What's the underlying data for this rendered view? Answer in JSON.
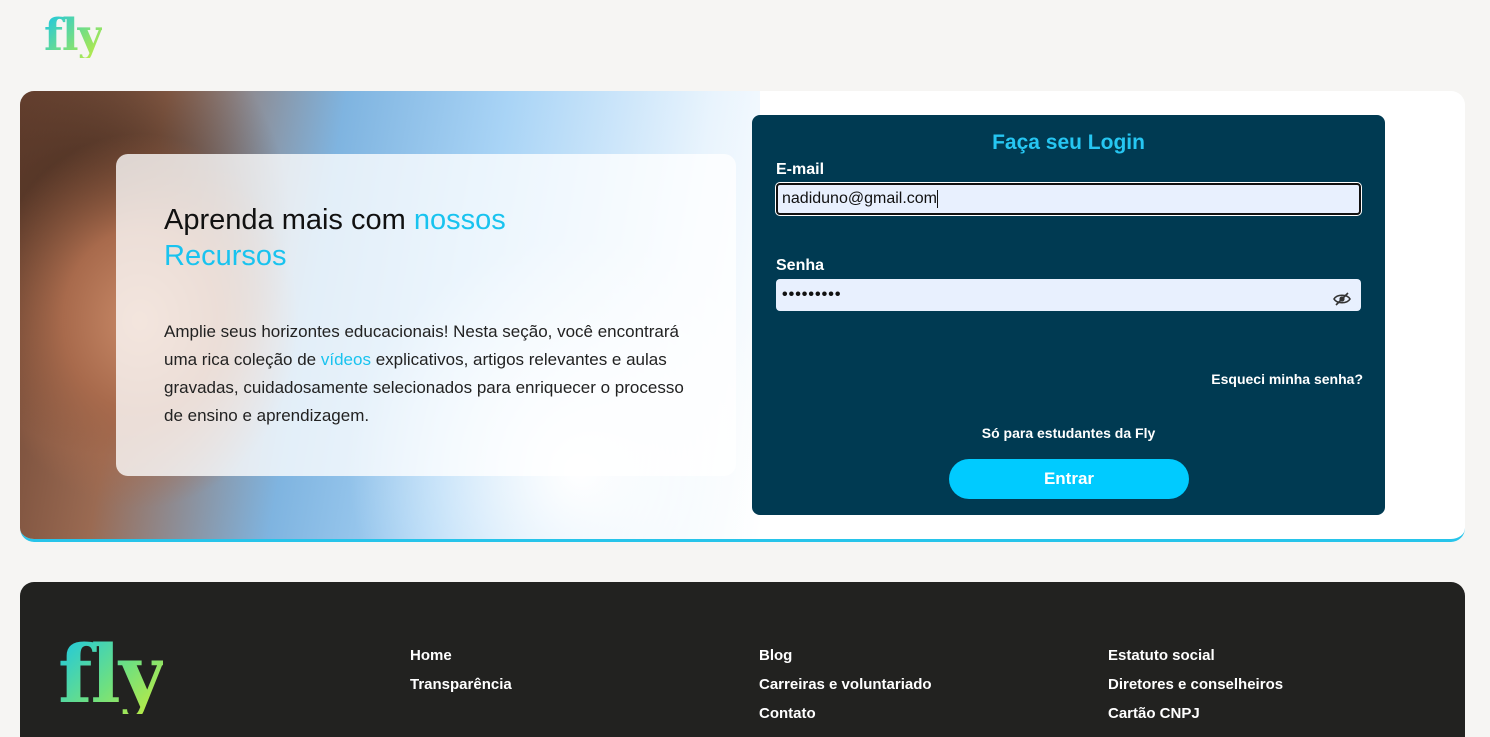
{
  "brand": {
    "logo_text": "fly",
    "accent": "#19c3ef",
    "login_bg": "#003a52",
    "button_bg": "#00cbff",
    "footer_bg": "#222220"
  },
  "hero": {
    "title_part1": "Aprenda mais com",
    "title_accent1": "nossos",
    "title_accent2": "Recursos",
    "text_before_link": "Amplie seus horizontes educacionais! Nesta seção, você encontrará uma rica coleção de",
    "text_link": "vídeos",
    "text_after_link": "explicativos, artigos relevantes e aulas gravadas, cuidadosamente selecionados para enriquecer o processo de ensino e aprendizagem."
  },
  "login": {
    "title": "Faça seu Login",
    "email_label": "E-mail",
    "email_value": "nadiduno@gmail.com",
    "password_label": "Senha",
    "password_value": "•••••••••",
    "password_toggle_icon": "eye-off-icon",
    "forgot_label": "Esqueci minha senha?",
    "students_only": "Só para estudantes da Fly",
    "submit_label": "Entrar"
  },
  "footer": {
    "logo_text": "fly",
    "col1": [
      "Home",
      "Transparência"
    ],
    "col2": [
      "Blog",
      "Carreiras e voluntariado",
      "Contato"
    ],
    "col3": [
      "Estatuto social",
      "Diretores e conselheiros",
      "Cartão CNPJ"
    ]
  }
}
